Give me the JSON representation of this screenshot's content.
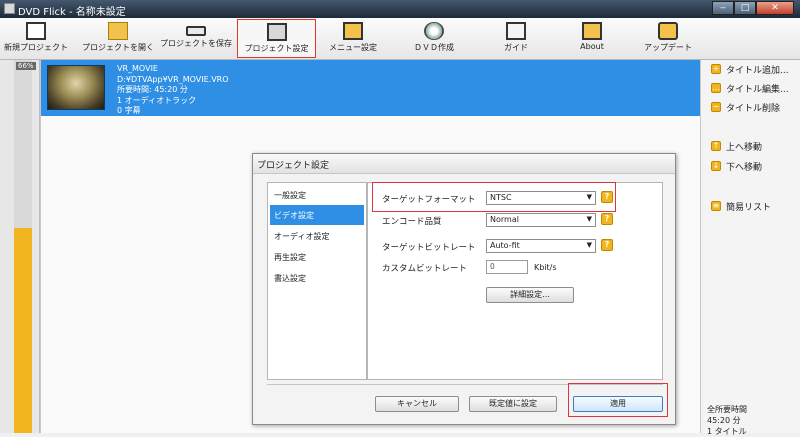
{
  "window": {
    "title": "DVD Flick - 名称未設定"
  },
  "toolbar": [
    {
      "label": "新規プロジェクト",
      "icon": "new-project-icon"
    },
    {
      "label": "プロジェクトを開く",
      "icon": "folder-icon"
    },
    {
      "label": "プロジェクトを保存",
      "icon": "save-icon"
    },
    {
      "label": "プロジェクト設定",
      "icon": "project-settings-icon",
      "active": true
    },
    {
      "label": "メニュー設定",
      "icon": "menu-settings-icon"
    },
    {
      "label": "ＤＶＤ作成",
      "icon": "dvd-icon"
    },
    {
      "label": "ガイド",
      "icon": "guide-icon"
    },
    {
      "label": "About",
      "icon": "about-icon"
    },
    {
      "label": "アップデート",
      "icon": "update-icon"
    }
  ],
  "meter": {
    "percent_label": "66%",
    "fill_fraction": 0.55,
    "color": "#f2b51f"
  },
  "titles": [
    {
      "name": "VR_MOVIE",
      "path": "D:¥DTVApp¥VR_MOVIE.VRO",
      "duration": "所要時間: 45:20 分",
      "audio": "1 オーディオトラック",
      "subtitle": "0 字幕"
    }
  ],
  "sidebar": {
    "items": [
      {
        "label": "タイトル追加...",
        "icon": "plus-icon"
      },
      {
        "label": "タイトル編集...",
        "icon": "edit-icon"
      },
      {
        "label": "タイトル削除",
        "icon": "minus-icon"
      },
      {
        "label": "上へ移動",
        "icon": "arrow-up-icon"
      },
      {
        "label": "下へ移動",
        "icon": "arrow-down-icon"
      },
      {
        "label": "簡易リスト",
        "icon": "list-icon"
      }
    ],
    "total_label": "全所要時間",
    "total_value": "45:20 分",
    "total_extra": "1 タイトル"
  },
  "dialog": {
    "title": "プロジェクト設定",
    "categories": [
      "一般設定",
      "ビデオ設定",
      "オーディオ設定",
      "再生設定",
      "書込設定"
    ],
    "selected_category": "ビデオ設定",
    "fields": {
      "target_format_label": "ターゲットフォーマット",
      "target_format_value": "NTSC",
      "encode_quality_label": "エンコード品質",
      "encode_quality_value": "Normal",
      "target_bitrate_label": "ターゲットビットレート",
      "target_bitrate_value": "Auto-fit",
      "custom_bitrate_label": "カスタムビットレート",
      "custom_bitrate_value": "0",
      "custom_bitrate_unit": "Kbit/s",
      "advanced_button": "詳細設定..."
    },
    "buttons": {
      "cancel": "キャンセル",
      "defaults": "既定値に設定",
      "apply": "適用"
    }
  },
  "colors": {
    "selection": "#2f8fe5",
    "accent": "#f2b51f",
    "highlight": "#d9363e"
  }
}
